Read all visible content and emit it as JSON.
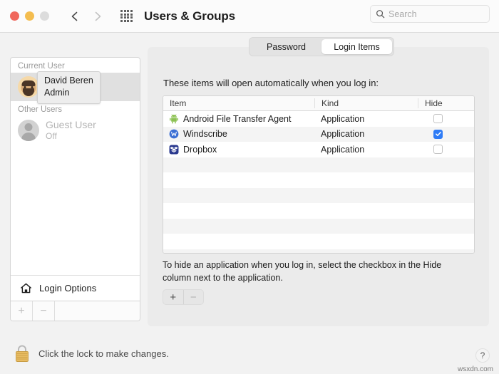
{
  "titlebar": {
    "title": "Users & Groups",
    "search_placeholder": "Search",
    "search_value": ""
  },
  "sidebar": {
    "current_user_header": "Current User",
    "other_users_header": "Other Users",
    "current_user": {
      "name": "David Beren",
      "role": "Admin"
    },
    "other_users": [
      {
        "name": "Guest User",
        "status": "Off"
      }
    ],
    "tooltip": {
      "line1": "David Beren",
      "line2": "Admin"
    },
    "login_options_label": "Login Options",
    "add_label": "+",
    "remove_label": "−"
  },
  "panel": {
    "tabs": [
      {
        "label": "Password",
        "active": false
      },
      {
        "label": "Login Items",
        "active": true
      }
    ],
    "intro": "These items will open automatically when you log in:",
    "table": {
      "columns": [
        "Item",
        "Kind",
        "Hide"
      ],
      "rows": [
        {
          "item": "Android File Transfer Agent",
          "kind": "Application",
          "hide": false,
          "icon": "android-icon"
        },
        {
          "item": "Windscribe",
          "kind": "Application",
          "hide": true,
          "icon": "windscribe-icon"
        },
        {
          "item": "Dropbox",
          "kind": "Application",
          "hide": false,
          "icon": "dropbox-icon"
        }
      ],
      "empty_row_count": 7
    },
    "note": "To hide an application when you log in, select the checkbox in the Hide column next to the application.",
    "add_label": "+",
    "remove_label": "−"
  },
  "bottom": {
    "lock_text": "Click the lock to make changes.",
    "help_label": "?",
    "watermark": "wsxdn.com"
  },
  "colors": {
    "accent": "#2f7cf6",
    "close": "#f0675c",
    "minimize": "#f4bd4f",
    "zoom_disabled": "#dcdcdc",
    "lock_gold": "#e8bc63"
  }
}
